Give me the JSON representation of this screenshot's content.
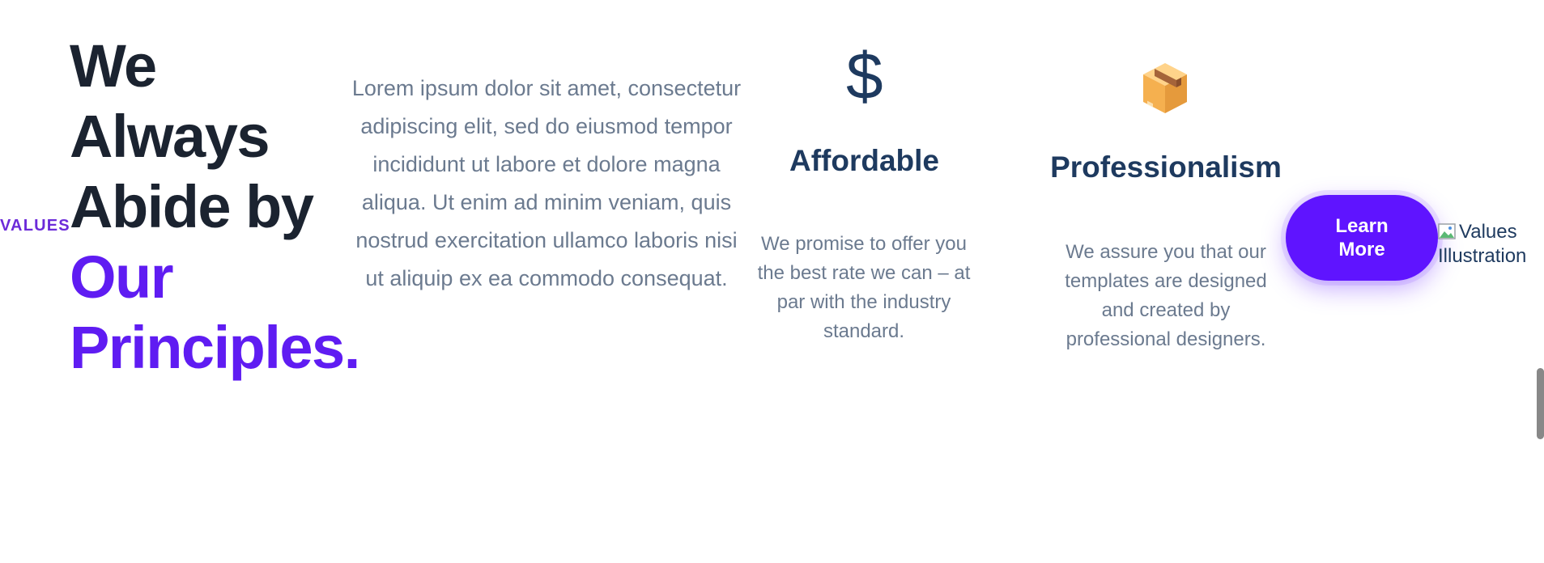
{
  "section": {
    "eyebrow": "VALUES",
    "headline": {
      "line1": "We",
      "line2": "Always",
      "line3": "Abide by",
      "accent_line1": "Our",
      "accent_line2": "Principles."
    },
    "intro_text": "Lorem ipsum dolor sit amet, consectetur adipiscing elit, sed do eiusmod tempor incididunt ut labore et dolore magna aliqua. Ut enim ad minim veniam, quis nostrud exercitation ullamco laboris nisi ut aliquip ex ea commodo consequat."
  },
  "cards": [
    {
      "icon": "dollar-icon",
      "icon_glyph": "$",
      "title": "Affordable",
      "description": "We promise to offer you the best rate we can – at par with the industry standard."
    },
    {
      "icon": "package-box-icon",
      "title": "Professionalism",
      "description": "We assure you that our templates are designed and created by professional designers."
    }
  ],
  "cta": {
    "label": "Learn More"
  },
  "image": {
    "alt": "Values Illustration"
  },
  "colors": {
    "accent": "#5f1cf2",
    "heading": "#1b2330",
    "title": "#1e3a5f",
    "body": "#6b7a8f",
    "button": "#5f14ff"
  }
}
